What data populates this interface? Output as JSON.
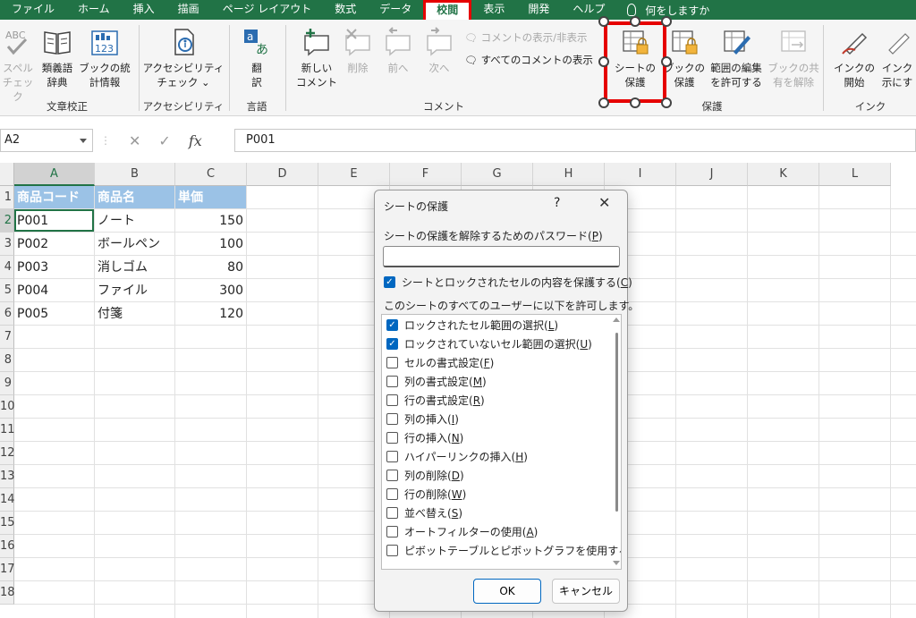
{
  "menu": {
    "tabs": [
      "ファイル",
      "ホーム",
      "挿入",
      "描画",
      "ページ レイアウト",
      "数式",
      "データ",
      "校閲",
      "表示",
      "開発",
      "ヘルプ"
    ],
    "active_tab": "校閲",
    "search_text": "何をしますか"
  },
  "ribbon": {
    "proofing": {
      "title": "文章校正",
      "spelling": "スペル\nチェック",
      "thesaurus": "類義語\n辞典",
      "workbook_stats": "ブックの統\n計情報"
    },
    "accessibility": {
      "title": "アクセシビリティ",
      "check": "アクセシビリティ\nチェック ⌄"
    },
    "language": {
      "title": "言語",
      "translate": "翻\n訳"
    },
    "comments": {
      "title": "コメント",
      "new": "新しい\nコメント",
      "delete": "削除",
      "prev": "前へ",
      "next": "次へ",
      "show_hide": "コメントの表示/非表示",
      "show_all": "すべてのコメントの表示"
    },
    "protect": {
      "title": "保護",
      "protect_sheet": "シートの\n保護",
      "protect_workbook": "ブックの\n保護",
      "allow_edit_ranges": "範囲の編集\nを許可する",
      "unshare_workbook": "ブックの共\n有を解除"
    },
    "ink": {
      "title": "インク",
      "start_inking": "インクの\n開始",
      "hide_ink": "インク\n示にす"
    }
  },
  "formula_bar": {
    "name_box": "A2",
    "cancel_glyph": "✕",
    "enter_glyph": "✓",
    "fx_glyph": "fx",
    "content": "P001"
  },
  "grid": {
    "columns": [
      "A",
      "B",
      "C",
      "D",
      "E",
      "F",
      "G",
      "H",
      "I",
      "J",
      "K",
      "L"
    ],
    "rows": [
      "1",
      "2",
      "3",
      "4",
      "5",
      "6",
      "7",
      "8",
      "9",
      "10",
      "11",
      "12",
      "13",
      "14",
      "15",
      "16",
      "17",
      "18"
    ],
    "headers": [
      "商品コード",
      "商品名",
      "単価"
    ],
    "data": [
      [
        "P001",
        "ノート",
        "150"
      ],
      [
        "P002",
        "ボールペン",
        "100"
      ],
      [
        "P003",
        "消しゴム",
        "80"
      ],
      [
        "P004",
        "ファイル",
        "300"
      ],
      [
        "P005",
        "付箋",
        "120"
      ]
    ],
    "selected_cell": "A2"
  },
  "dialog": {
    "title": "シートの保護",
    "help_glyph": "?",
    "close_glyph": "✕",
    "password_label_pre": "シートの保護を解除するためのパスワード(",
    "password_label_key": "P",
    "password_label_post": ")",
    "password_value": "",
    "protect_contents_pre": "シートとロックされたセルの内容を保護する(",
    "protect_contents_key": "C",
    "protect_contents_post": ")",
    "allow_label": "このシートのすべてのユーザーに以下を許可します。",
    "options": [
      {
        "pre": "ロックされたセル範囲の選択(",
        "key": "L",
        "post": ")",
        "checked": true
      },
      {
        "pre": "ロックされていないセル範囲の選択(",
        "key": "U",
        "post": ")",
        "checked": true
      },
      {
        "pre": "セルの書式設定(",
        "key": "F",
        "post": ")",
        "checked": false
      },
      {
        "pre": "列の書式設定(",
        "key": "M",
        "post": ")",
        "checked": false
      },
      {
        "pre": "行の書式設定(",
        "key": "R",
        "post": ")",
        "checked": false
      },
      {
        "pre": "列の挿入(",
        "key": "I",
        "post": ")",
        "checked": false
      },
      {
        "pre": "行の挿入(",
        "key": "N",
        "post": ")",
        "checked": false
      },
      {
        "pre": "ハイパーリンクの挿入(",
        "key": "H",
        "post": ")",
        "checked": false
      },
      {
        "pre": "列の削除(",
        "key": "D",
        "post": ")",
        "checked": false
      },
      {
        "pre": "行の削除(",
        "key": "W",
        "post": ")",
        "checked": false
      },
      {
        "pre": "並べ替え(",
        "key": "S",
        "post": ")",
        "checked": false
      },
      {
        "pre": "オートフィルターの使用(",
        "key": "A",
        "post": ")",
        "checked": false
      },
      {
        "pre": "ピボットテーブルとピボットグラフを使用する",
        "key": "",
        "post": "",
        "checked": false
      }
    ],
    "ok_label": "OK",
    "cancel_label": "キャンセル"
  },
  "colors": {
    "excel_green": "#217346",
    "highlight_red": "#e60000",
    "header_fill": "#9bc2e6",
    "checkbox_blue": "#0067c0"
  }
}
